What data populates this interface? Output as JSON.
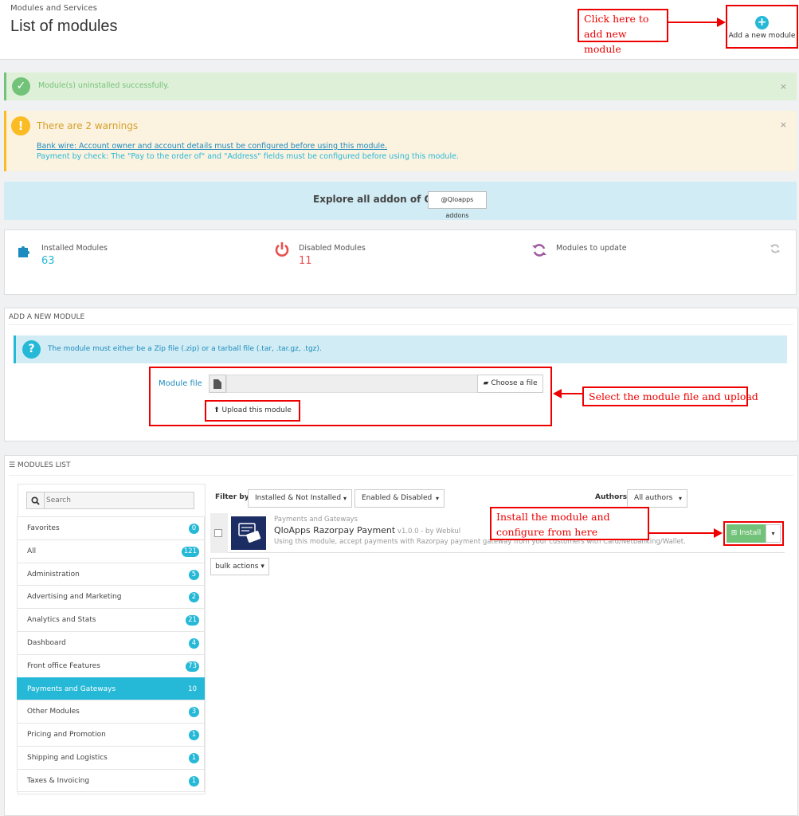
{
  "header": {
    "breadcrumb": "Modules and Services",
    "title": "List of modules",
    "add_module_label": "Add a new module"
  },
  "callouts": {
    "add_module": "Click here to add new module",
    "select_file": "Select the module file and upload",
    "install": "Install the module and configure from here"
  },
  "alerts": {
    "success": "Module(s) uninstalled successfully.",
    "warning_title": "There are 2 warnings",
    "warning_1": "Bank wire: Account owner and account details must be configured before using this module.",
    "warning_2": "Payment by check: The \"Pay to the order of\" and \"Address\" fields must be configured before using this module.",
    "close": "×"
  },
  "explore": {
    "text": "Explore all addon of Qloapps",
    "button": "@Qloapps addons"
  },
  "stats": {
    "installed_label": "Installed Modules",
    "installed_value": "63",
    "disabled_label": "Disabled Modules",
    "disabled_value": "11",
    "update_label": "Modules to update"
  },
  "add_module": {
    "heading": "ADD A NEW MODULE",
    "info": "The module must either be a Zip file (.zip) or a tarball file (.tar, .tar.gz, .tgz).",
    "file_label": "Module file",
    "choose_button": "Choose a file",
    "upload_button": "Upload this module"
  },
  "modules_list": {
    "heading": "MODULES LIST",
    "search_placeholder": "Search",
    "filter_label": "Filter by",
    "filter_install": "Installed & Not Installed",
    "filter_enabled": "Enabled & Disabled",
    "authors_label": "Authors",
    "authors_value": "All authors",
    "bulk_actions": "bulk actions",
    "categories": [
      {
        "label": "Favorites",
        "count": "0"
      },
      {
        "label": "All",
        "count": "121"
      },
      {
        "label": "Administration",
        "count": "5"
      },
      {
        "label": "Advertising and Marketing",
        "count": "2"
      },
      {
        "label": "Analytics and Stats",
        "count": "21"
      },
      {
        "label": "Dashboard",
        "count": "4"
      },
      {
        "label": "Front office Features",
        "count": "73"
      },
      {
        "label": "Payments and Gateways",
        "count": "10"
      },
      {
        "label": "Other Modules",
        "count": "3"
      },
      {
        "label": "Pricing and Promotion",
        "count": "1"
      },
      {
        "label": "Shipping and Logistics",
        "count": "1"
      },
      {
        "label": "Taxes & Invoicing",
        "count": "1"
      }
    ],
    "module": {
      "category": "Payments and Gateways",
      "name": "QloApps Razorpay Payment",
      "version": " v1.0.0 - by Webkul",
      "description": "Using this module, accept payments with Razorpay payment gateway from your customers with Card/Netbanking/Wallet.",
      "install_label": "Install"
    }
  },
  "colors": {
    "accent": "#25b9d7",
    "success": "#72c279",
    "warning": "#fbbb22",
    "danger": "#e84e4e",
    "annotation": "#ee0000"
  }
}
